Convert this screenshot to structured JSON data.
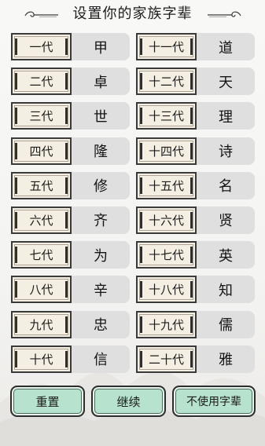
{
  "title": "设置你的家族字辈",
  "generations": [
    {
      "label": "一代",
      "char": "甲"
    },
    {
      "label": "十一代",
      "char": "道"
    },
    {
      "label": "二代",
      "char": "卓"
    },
    {
      "label": "十二代",
      "char": "天"
    },
    {
      "label": "三代",
      "char": "世"
    },
    {
      "label": "十三代",
      "char": "理"
    },
    {
      "label": "四代",
      "char": "隆"
    },
    {
      "label": "十四代",
      "char": "诗"
    },
    {
      "label": "五代",
      "char": "修"
    },
    {
      "label": "十五代",
      "char": "名"
    },
    {
      "label": "六代",
      "char": "齐"
    },
    {
      "label": "十六代",
      "char": "贤"
    },
    {
      "label": "七代",
      "char": "为"
    },
    {
      "label": "十七代",
      "char": "英"
    },
    {
      "label": "八代",
      "char": "辛"
    },
    {
      "label": "十八代",
      "char": "知"
    },
    {
      "label": "九代",
      "char": "忠"
    },
    {
      "label": "十九代",
      "char": "儒"
    },
    {
      "label": "十代",
      "char": "信"
    },
    {
      "label": "二十代",
      "char": "雅"
    }
  ],
  "buttons": {
    "reset": "重置",
    "continue": "继续",
    "no_generation_names": "不使用字辈"
  },
  "colors": {
    "button_fill": "#b7e2cd",
    "label_fill": "#f4efe2",
    "cell_fill": "#dfdfdf"
  }
}
